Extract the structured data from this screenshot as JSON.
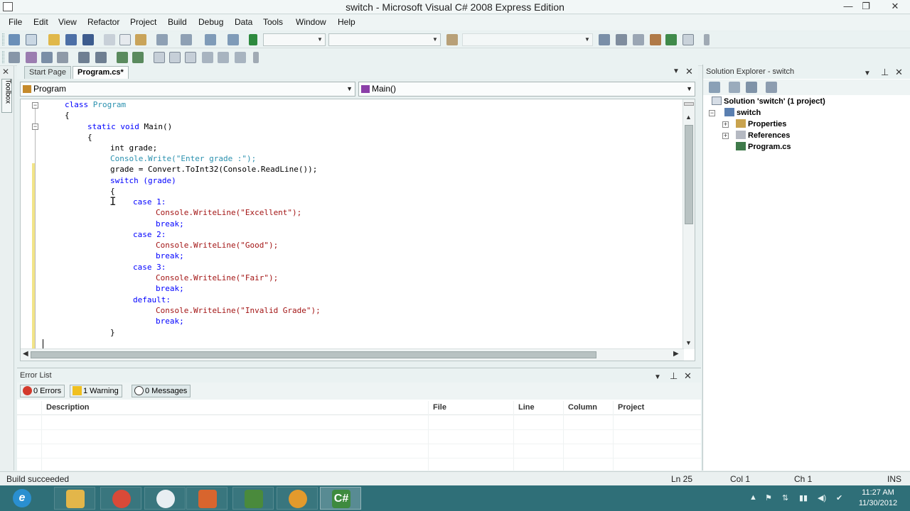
{
  "window": {
    "title": "switch - Microsoft Visual C# 2008 Express Edition",
    "minimize": "—",
    "restore": "❐",
    "close": "✕"
  },
  "menu": [
    "File",
    "Edit",
    "View",
    "Refactor",
    "Project",
    "Build",
    "Debug",
    "Data",
    "Tools",
    "Window",
    "Help"
  ],
  "toolbox": {
    "label": "Toolbox",
    "close": "✕"
  },
  "doc_tabs": {
    "tabs": [
      {
        "label": "Start Page",
        "active": false
      },
      {
        "label": "Program.cs*",
        "active": true
      }
    ],
    "dropdown": "▼",
    "close": "✕"
  },
  "navigation": {
    "class_combo": "Program",
    "member_combo": "Main()",
    "arrow": "▼"
  },
  "editor": {
    "code_lines": [
      "class Program",
      "{",
      "static void Main()",
      "{",
      "int grade;",
      "Console.Write(\"Enter grade :\");",
      "grade = Convert.ToInt32(Console.ReadLine());",
      "switch (grade)",
      "{",
      "case 1:",
      "Console.WriteLine(\"Excellent\");",
      "break;",
      "case 2:",
      "Console.WriteLine(\"Good\");",
      "break;",
      "case 3:",
      "Console.WriteLine(\"Fair\");",
      "break;",
      "default:",
      "Console.WriteLine(\"Invalid Grade\");",
      "break;",
      "}"
    ],
    "colors": {
      "keyword": "#0000ff",
      "type": "#2b91af",
      "string": "#a31515",
      "changed_line_marker": "#f2e488"
    }
  },
  "solution_explorer": {
    "title": "Solution Explorer - switch",
    "solution": "Solution 'switch' (1 project)",
    "project": "switch",
    "items": [
      "Properties",
      "References",
      "Program.cs"
    ],
    "icons": [
      "solution-icon",
      "project-icon",
      "folder-icon",
      "references-icon",
      "cs-file-icon"
    ]
  },
  "error_list": {
    "title": "Error List",
    "filters": {
      "errors": "0 Errors",
      "warnings": "1 Warning",
      "messages": "0 Messages"
    },
    "columns": {
      "description": "Description",
      "file": "File",
      "line": "Line",
      "column": "Column",
      "project": "Project"
    }
  },
  "status_bar": {
    "message": "Build succeeded",
    "ln": "Ln 25",
    "col": "Col 1",
    "ch": "Ch 1",
    "mode": "INS"
  },
  "taskbar": {
    "apps": [
      "ie-icon",
      "explorer-icon",
      "chrome-icon",
      "clock-app-icon",
      "presentation-icon",
      "game-icon",
      "media-player-icon",
      "visual-csharp-icon"
    ],
    "clock_time": "11:27 AM",
    "clock_date": "11/30/2012"
  }
}
